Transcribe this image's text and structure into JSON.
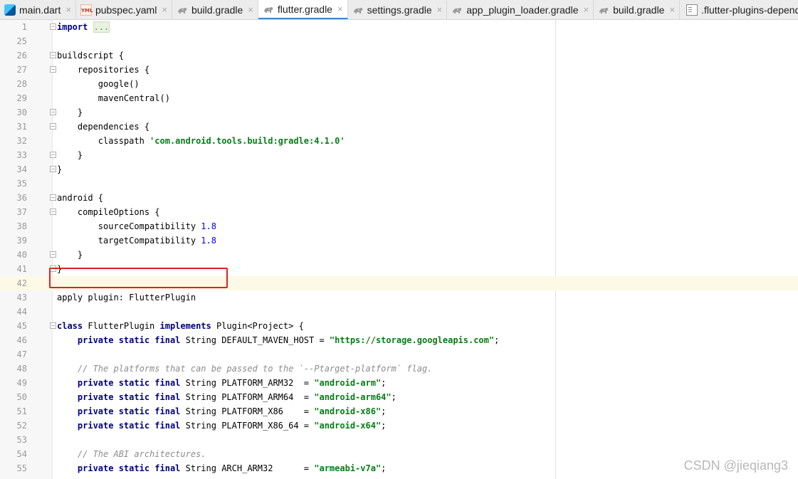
{
  "tabs": [
    {
      "label": "main.dart",
      "icon": "dart-file-icon",
      "active": false
    },
    {
      "label": "pubspec.yaml",
      "icon": "yaml-file-icon",
      "active": false
    },
    {
      "label": "build.gradle",
      "icon": "gradle-file-icon",
      "active": false
    },
    {
      "label": "flutter.gradle",
      "icon": "gradle-file-icon",
      "active": true
    },
    {
      "label": "settings.gradle",
      "icon": "gradle-file-icon",
      "active": false
    },
    {
      "label": "app_plugin_loader.gradle",
      "icon": "gradle-file-icon",
      "active": false
    },
    {
      "label": "build.gradle",
      "icon": "gradle-file-icon",
      "active": false
    },
    {
      "label": ".flutter-plugins-dependencies",
      "icon": "text-file-icon",
      "active": false
    }
  ],
  "tab_close_glyph": "×",
  "colors": {
    "keyword": "#000080",
    "string": "#067d17",
    "number": "#0000ff",
    "comment": "#8c8c8c",
    "highlight_box": "#e02020",
    "active_tab_underline": "#4083c9"
  },
  "current_line": "42",
  "lines": [
    {
      "n": "1",
      "fold": "start",
      "tokens": [
        [
          "kw",
          "import"
        ],
        [
          "t",
          " "
        ],
        [
          "fold",
          "..."
        ]
      ]
    },
    {
      "n": "25",
      "tokens": []
    },
    {
      "n": "26",
      "fold": "start",
      "tokens": [
        [
          "t",
          "buildscript {"
        ]
      ]
    },
    {
      "n": "27",
      "fold": "start",
      "tokens": [
        [
          "t",
          "    repositories {"
        ]
      ]
    },
    {
      "n": "28",
      "tokens": [
        [
          "t",
          "        google()"
        ]
      ]
    },
    {
      "n": "29",
      "tokens": [
        [
          "t",
          "        mavenCentral()"
        ]
      ]
    },
    {
      "n": "30",
      "fold": "end",
      "tokens": [
        [
          "t",
          "    }"
        ]
      ]
    },
    {
      "n": "31",
      "fold": "start",
      "tokens": [
        [
          "t",
          "    dependencies {"
        ]
      ]
    },
    {
      "n": "32",
      "tokens": [
        [
          "t",
          "        classpath "
        ],
        [
          "str",
          "'com.android.tools.build:gradle:4.1.0'"
        ]
      ]
    },
    {
      "n": "33",
      "fold": "end",
      "tokens": [
        [
          "t",
          "    }"
        ]
      ]
    },
    {
      "n": "34",
      "fold": "end",
      "tokens": [
        [
          "t",
          "}"
        ]
      ]
    },
    {
      "n": "35",
      "tokens": []
    },
    {
      "n": "36",
      "fold": "start",
      "tokens": [
        [
          "t",
          "android {"
        ]
      ]
    },
    {
      "n": "37",
      "fold": "start",
      "tokens": [
        [
          "t",
          "    compileOptions {"
        ]
      ]
    },
    {
      "n": "38",
      "tokens": [
        [
          "t",
          "        sourceCompatibility "
        ],
        [
          "num",
          "1.8"
        ]
      ]
    },
    {
      "n": "39",
      "tokens": [
        [
          "t",
          "        targetCompatibility "
        ],
        [
          "num",
          "1.8"
        ]
      ]
    },
    {
      "n": "40",
      "fold": "end",
      "tokens": [
        [
          "t",
          "    }"
        ]
      ]
    },
    {
      "n": "41",
      "fold": "end",
      "tokens": [
        [
          "t",
          "}"
        ]
      ]
    },
    {
      "n": "42",
      "tokens": []
    },
    {
      "n": "43",
      "tokens": [
        [
          "t",
          "apply plugin: FlutterPlugin"
        ]
      ]
    },
    {
      "n": "44",
      "tokens": []
    },
    {
      "n": "45",
      "fold": "start",
      "tokens": [
        [
          "kw",
          "class"
        ],
        [
          "t",
          " FlutterPlugin "
        ],
        [
          "kw",
          "implements"
        ],
        [
          "t",
          " Plugin<Project> {"
        ]
      ]
    },
    {
      "n": "46",
      "tokens": [
        [
          "t",
          "    "
        ],
        [
          "kw",
          "private static final"
        ],
        [
          "t",
          " String DEFAULT_MAVEN_HOST = "
        ],
        [
          "str",
          "\"https://storage.googleapis.com\""
        ],
        [
          "t",
          ";"
        ]
      ]
    },
    {
      "n": "47",
      "tokens": []
    },
    {
      "n": "48",
      "tokens": [
        [
          "t",
          "    "
        ],
        [
          "cmt",
          "// The platforms that can be passed to the `--Ptarget-platform` flag."
        ]
      ]
    },
    {
      "n": "49",
      "tokens": [
        [
          "t",
          "    "
        ],
        [
          "kw",
          "private static final"
        ],
        [
          "t",
          " String PLATFORM_ARM32  = "
        ],
        [
          "str",
          "\"android-arm\""
        ],
        [
          "t",
          ";"
        ]
      ]
    },
    {
      "n": "50",
      "tokens": [
        [
          "t",
          "    "
        ],
        [
          "kw",
          "private static final"
        ],
        [
          "t",
          " String PLATFORM_ARM64  = "
        ],
        [
          "str",
          "\"android-arm64\""
        ],
        [
          "t",
          ";"
        ]
      ]
    },
    {
      "n": "51",
      "tokens": [
        [
          "t",
          "    "
        ],
        [
          "kw",
          "private static final"
        ],
        [
          "t",
          " String PLATFORM_X86    = "
        ],
        [
          "str",
          "\"android-x86\""
        ],
        [
          "t",
          ";"
        ]
      ]
    },
    {
      "n": "52",
      "tokens": [
        [
          "t",
          "    "
        ],
        [
          "kw",
          "private static final"
        ],
        [
          "t",
          " String PLATFORM_X86_64 = "
        ],
        [
          "str",
          "\"android-x64\""
        ],
        [
          "t",
          ";"
        ]
      ]
    },
    {
      "n": "53",
      "tokens": []
    },
    {
      "n": "54",
      "tokens": [
        [
          "t",
          "    "
        ],
        [
          "cmt",
          "// The ABI architectures."
        ]
      ]
    },
    {
      "n": "55",
      "tokens": [
        [
          "t",
          "    "
        ],
        [
          "kw",
          "private static final"
        ],
        [
          "t",
          " String ARCH_ARM32      = "
        ],
        [
          "str",
          "\"armeabi-v7a\""
        ],
        [
          "t",
          ";"
        ]
      ]
    }
  ],
  "highlighted_line": "43",
  "watermark": "CSDN @jieqiang3"
}
